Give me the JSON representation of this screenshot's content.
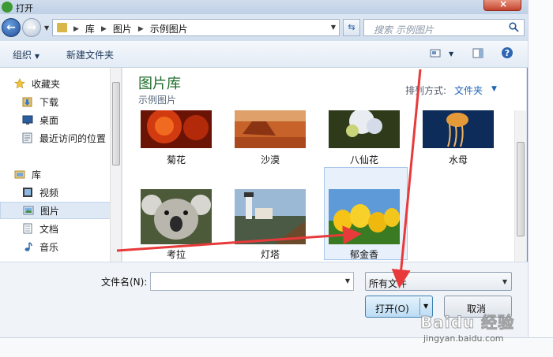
{
  "window": {
    "title": "打开",
    "close_glyph": "×"
  },
  "nav": {
    "address_parts": [
      "库",
      "图片",
      "示例图片"
    ],
    "search_placeholder": "搜索 示例图片"
  },
  "toolbar": {
    "organize": "组织",
    "new_folder": "新建文件夹"
  },
  "sidebar": {
    "items": [
      {
        "label": "收藏夹",
        "icon": "star-icon"
      },
      {
        "label": "下载",
        "icon": "download-icon"
      },
      {
        "label": "桌面",
        "icon": "desktop-icon"
      },
      {
        "label": "最近访问的位置",
        "icon": "recent-places-icon"
      },
      {
        "label": "库",
        "icon": "library-icon"
      },
      {
        "label": "视频",
        "icon": "video-icon"
      },
      {
        "label": "图片",
        "icon": "pictures-icon"
      },
      {
        "label": "文档",
        "icon": "documents-icon"
      },
      {
        "label": "音乐",
        "icon": "music-icon"
      }
    ]
  },
  "content": {
    "library_title": "图片库",
    "library_subtitle": "示例图片",
    "arrange_label": "排列方式:",
    "arrange_value": "文件夹",
    "files": [
      "菊花",
      "沙漠",
      "八仙花",
      "水母",
      "考拉",
      "灯塔",
      "郁金香"
    ]
  },
  "bottom": {
    "filename_label": "文件名(N):",
    "filename_value": "",
    "filetype_value": "所有文件",
    "open_label": "打开(O)",
    "cancel_label": "取消"
  },
  "watermark": {
    "main": "Baidu 经验",
    "sub": "jingyan.baidu.com"
  },
  "colors": {
    "library_title": "#1e6e2a",
    "arrow": "#e83a3a",
    "accent_link": "#1d63b5"
  }
}
